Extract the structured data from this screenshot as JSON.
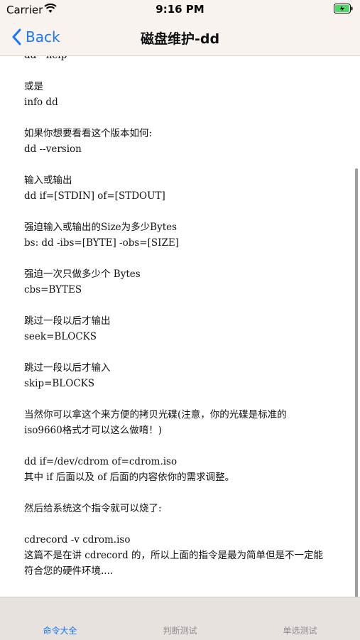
{
  "status_bar": {
    "carrier": "Carrier",
    "time": "9:16 PM"
  },
  "nav": {
    "back_label": "Back",
    "title": "磁盘维护-dd"
  },
  "content_lines": [
    "dd --help",
    "",
    "或是",
    "info dd",
    "",
    "如果你想要看看这个版本如何:",
    "dd --version",
    "",
    "输入或输出",
    "dd if=[STDIN] of=[STDOUT]",
    "",
    "强迫输入或输出的Size为多少Bytes",
    "bs: dd -ibs=[BYTE] -obs=[SIZE]",
    "",
    "强迫一次只做多少个 Bytes",
    "cbs=BYTES",
    "",
    "跳过一段以后才输出",
    "seek=BLOCKS",
    "",
    "跳过一段以后才输入",
    "skip=BLOCKS",
    "",
    "当然你可以拿这个来方便的拷贝光碟(注意，你的光碟是标准的",
    "iso9660格式才可以这么做唷！)",
    "",
    "dd if=/dev/cdrom of=cdrom.iso",
    "其中 if 后面以及 of 后面的内容依你的需求调整。",
    "",
    "然后给系统这个指令就可以烧了:",
    "",
    "cdrecord -v cdrom.iso",
    "这篇不是在讲 cdrecord 的，所以上面的指令是最为简单但是不一定能",
    "符合您的硬件环境...."
  ],
  "tabs": [
    {
      "label": "命令大全",
      "active": true
    },
    {
      "label": "判断测试",
      "active": false
    },
    {
      "label": "单选测试",
      "active": false
    }
  ],
  "colors": {
    "accent": "#1677ff",
    "bar_background": "#f8f3ee",
    "tab_background": "#e7e2dd"
  },
  "icons": [
    "wifi-icon",
    "battery-icon",
    "chevron-left-icon"
  ]
}
